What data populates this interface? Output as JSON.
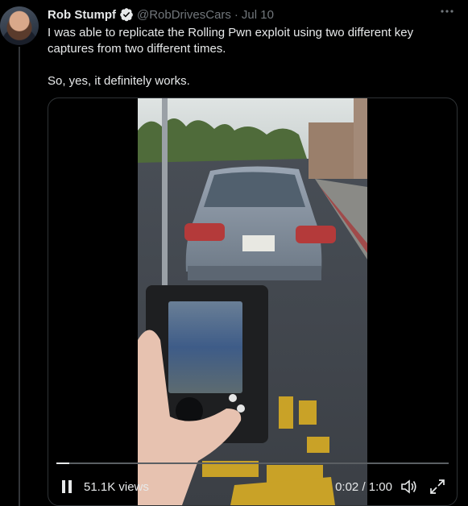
{
  "tweet": {
    "author_name": "Rob Stumpf",
    "handle": "@RobDrivesCars",
    "separator": "·",
    "date": "Jul 10",
    "text": "I was able to replicate the Rolling Pwn exploit using two different key captures from two different times.\n\nSo, yes, it definitely works.",
    "more_icon": "more-horizontal-icon"
  },
  "video": {
    "views": "51.1K views",
    "current_time": "0:02",
    "duration": "1:00",
    "progress": 0.033,
    "time_separator": " / "
  },
  "colors": {
    "background": "#000000",
    "text": "#e7e9ea",
    "secondary": "#71767b",
    "verified": "#e7e9ea"
  }
}
